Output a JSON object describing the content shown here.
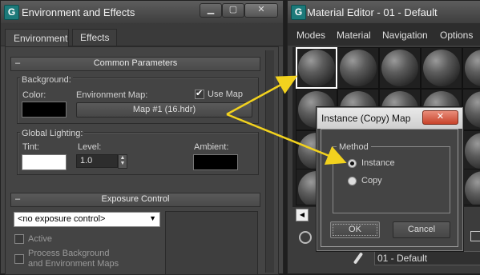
{
  "env_window": {
    "title": "Environment and Effects",
    "tabs": [
      "Environment",
      "Effects"
    ],
    "common_params": {
      "header": "Common Parameters",
      "background_label": "Background:",
      "color_label": "Color:",
      "env_map_label": "Environment Map:",
      "use_map_label": "Use Map",
      "map_button": "Map #1 (16.hdr)"
    },
    "global_lighting": {
      "label": "Global Lighting:",
      "tint_label": "Tint:",
      "level_label": "Level:",
      "level_value": "1.0",
      "ambient_label": "Ambient:"
    },
    "exposure": {
      "header": "Exposure Control",
      "dropdown_value": "<no exposure control>",
      "active_label": "Active",
      "process_line1": "Process Background",
      "process_line2": "and Environment Maps"
    },
    "colors": {
      "background_color": "#000000",
      "tint_color": "#ffffff",
      "ambient_color": "#000000"
    }
  },
  "mat_window": {
    "title": "Material Editor - 01 - Default",
    "menu": [
      "Modes",
      "Material",
      "Navigation",
      "Options"
    ],
    "material_name": "01 - Default"
  },
  "dialog": {
    "title": "Instance (Copy) Map",
    "method_label": "Method",
    "options": [
      "Instance",
      "Copy"
    ],
    "selected_option": "Instance",
    "ok_label": "OK",
    "cancel_label": "Cancel"
  },
  "arrow_color": "#f2d21e"
}
